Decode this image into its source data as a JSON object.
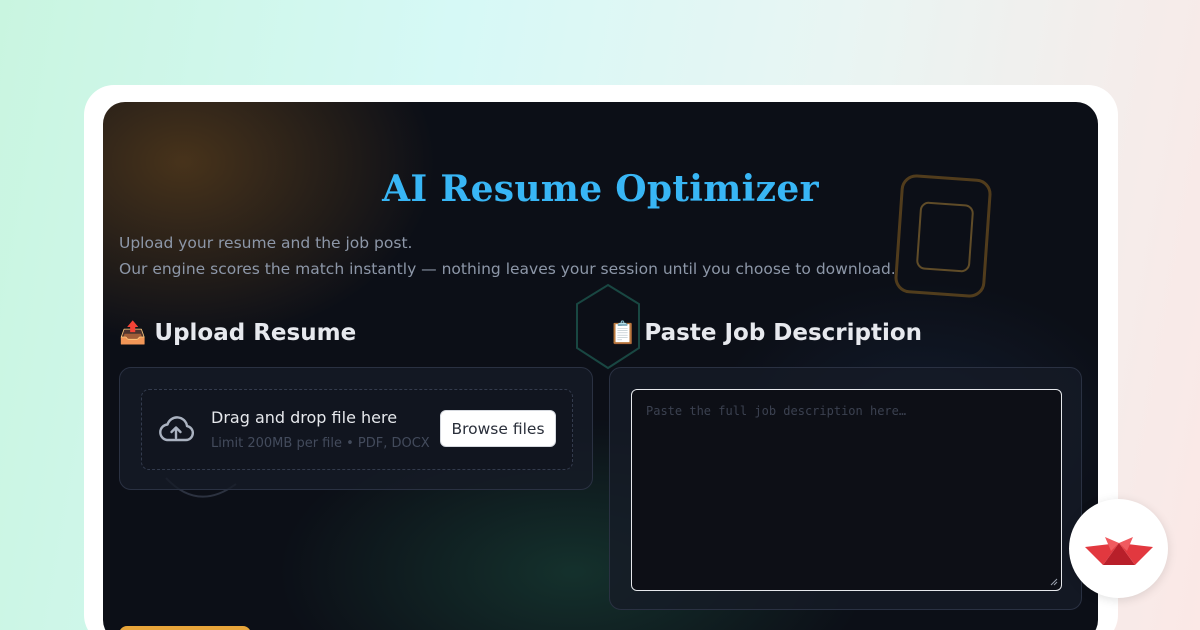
{
  "app": {
    "title": "AI Resume Optimizer",
    "subtitle_line1": "Upload your resume and the job post.",
    "subtitle_line2": "Our engine scores the match instantly — nothing leaves your session until you choose to download."
  },
  "upload": {
    "emoji": "📤",
    "heading": "Upload Resume",
    "icon": "cloud-upload-icon",
    "dropzone_title": "Drag and drop file here",
    "dropzone_hint": "Limit 200MB per file • PDF, DOCX",
    "browse_label": "Browse files"
  },
  "job": {
    "emoji": "📋",
    "heading": "Paste Job Description",
    "placeholder": "Paste the full job description here…",
    "value": ""
  },
  "badge": {
    "icon": "crown-logo-icon"
  },
  "colors": {
    "accent_title": "#38b6f5",
    "background": "#0c0f17",
    "card": "#161b26",
    "primary_button": "#e8a53a",
    "badge_red": "#e2383f"
  }
}
